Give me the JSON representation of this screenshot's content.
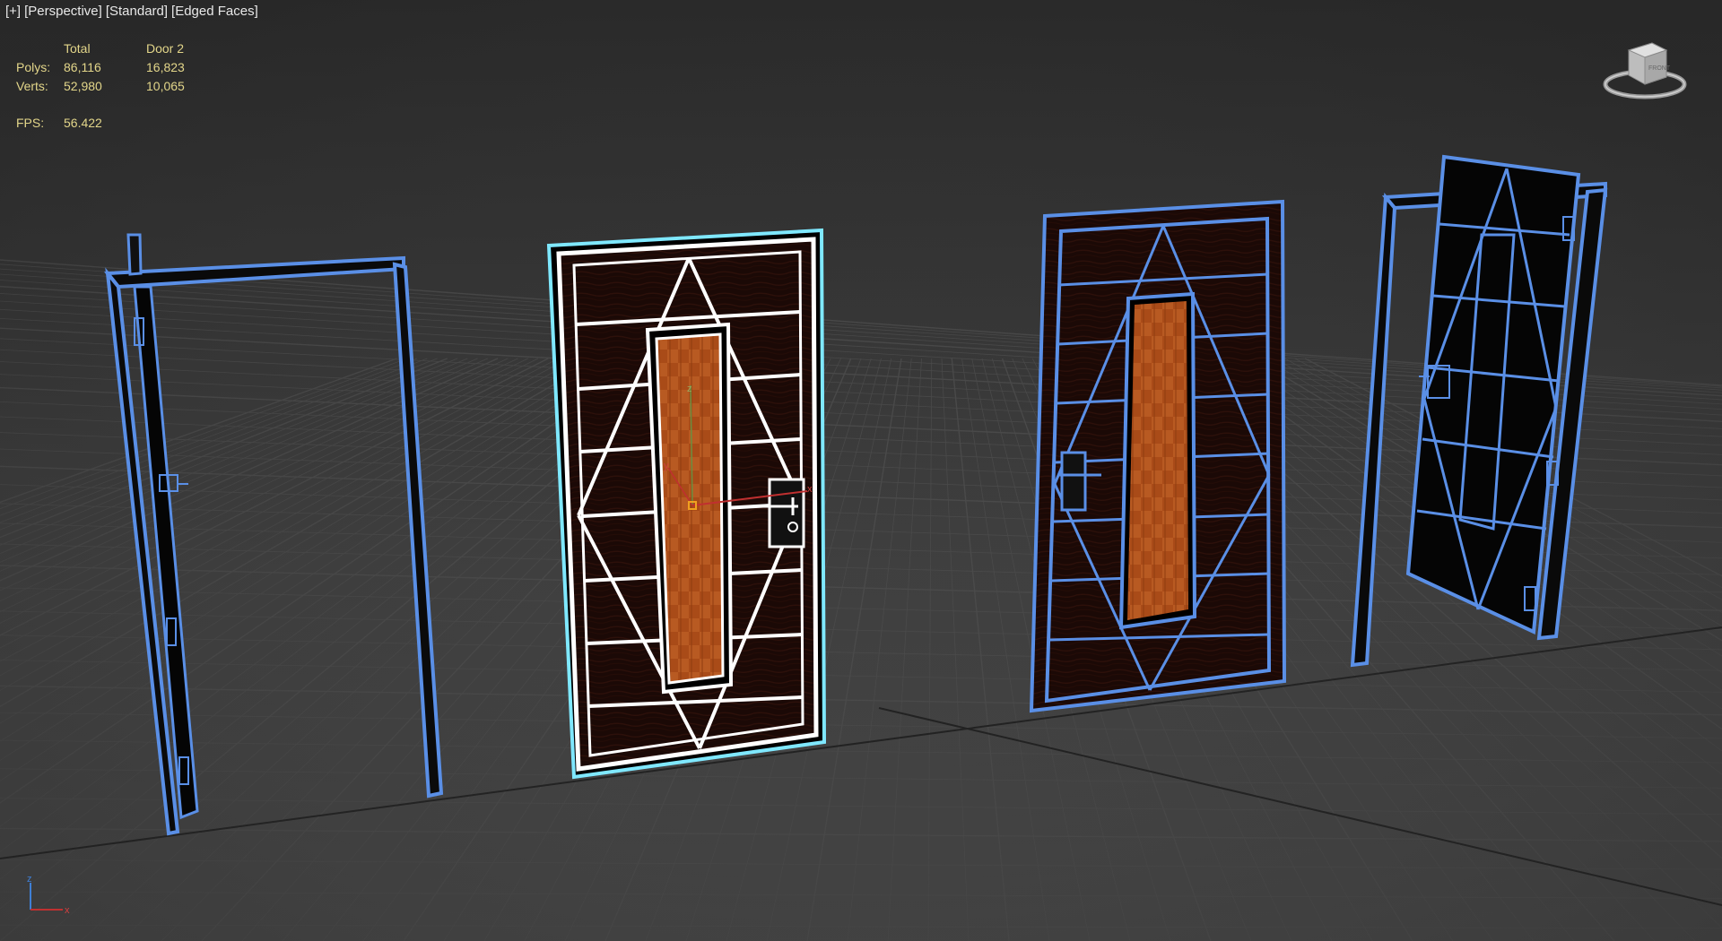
{
  "viewport": {
    "labels": [
      "[+]",
      "[Perspective]",
      "[Standard]",
      "[Edged Faces]"
    ]
  },
  "stats": {
    "headers": [
      "",
      "Total",
      "Door 2"
    ],
    "rows": [
      {
        "label": "Polys:",
        "total": "86,116",
        "selected": "16,823"
      },
      {
        "label": "Verts:",
        "total": "52,980",
        "selected": "10,065"
      }
    ],
    "fps_label": "FPS:",
    "fps_value": "56.422"
  },
  "viewcube": {
    "face_label": "FRONT"
  },
  "gizmo": {
    "axes": [
      "z",
      "y",
      "x"
    ]
  },
  "tripod": {
    "axes": [
      "z",
      "x"
    ]
  },
  "colors": {
    "selection_white": "#ffffff",
    "selection_outline": "#7fe8ff",
    "wire_blue": "#5a8fe6",
    "wood_orange": "#b2531c",
    "stats_yellow": "#e3d68a",
    "grid": "#4e4e4e"
  },
  "icons": [
    "viewcube-icon",
    "axis-tripod-icon",
    "transform-gizmo-icon",
    "door-handle-icon",
    "door-lock-icon",
    "door-hinge-icon"
  ]
}
